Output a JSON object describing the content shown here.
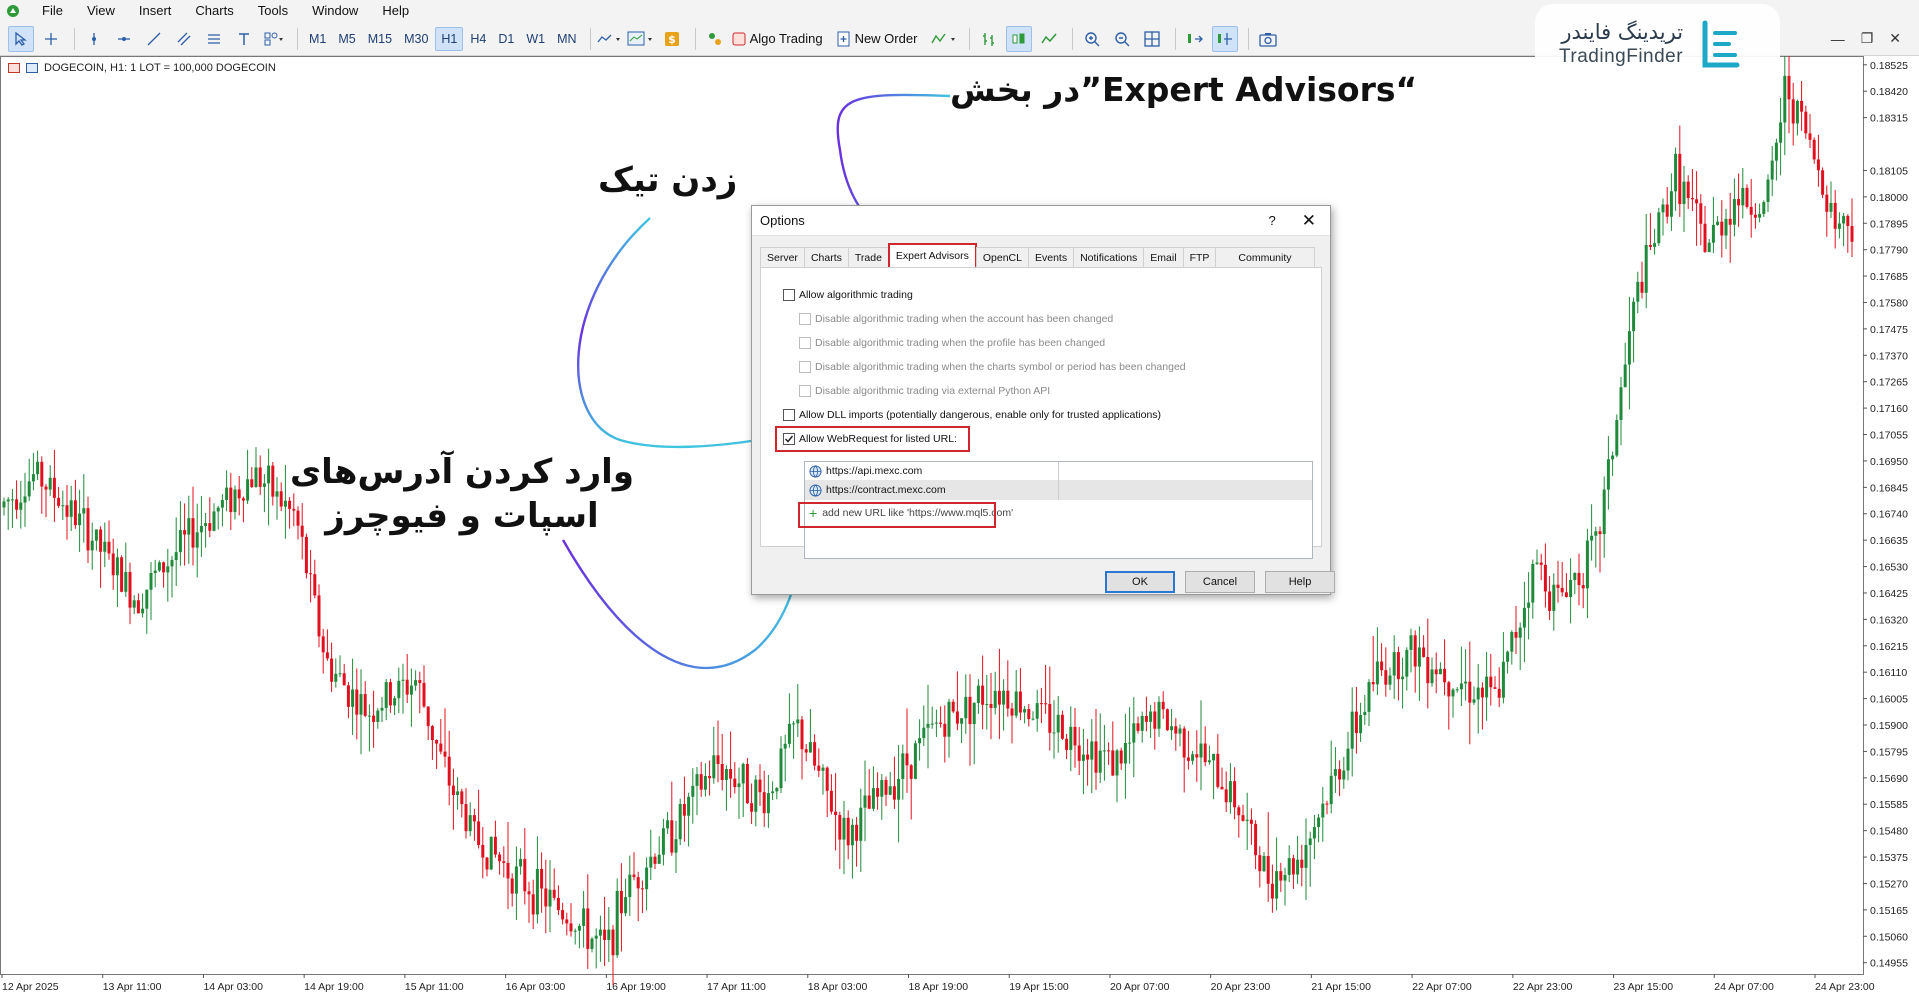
{
  "menu": [
    "File",
    "View",
    "Insert",
    "Charts",
    "Tools",
    "Window",
    "Help"
  ],
  "toolbar": {
    "timeframes": [
      "M1",
      "M5",
      "M15",
      "M30",
      "H1",
      "H4",
      "D1",
      "W1",
      "MN"
    ],
    "active_timeframe": "H1",
    "algo_trading": "Algo Trading",
    "new_order": "New Order"
  },
  "chart": {
    "header": "DOGECOIN, H1:  1 LOT = 100,000 DOGECOIN",
    "price_labels": [
      "0.18525",
      "0.18420",
      "0.18315",
      "0.18105",
      "0.18000",
      "0.17895",
      "0.17790",
      "0.17685",
      "0.17580",
      "0.17475",
      "0.17370",
      "0.17265",
      "0.17160",
      "0.17055",
      "0.16950",
      "0.16845",
      "0.16740",
      "0.16635",
      "0.16530",
      "0.16425",
      "0.16320",
      "0.16215",
      "0.16110",
      "0.16005",
      "0.15900",
      "0.15795",
      "0.15690",
      "0.15585",
      "0.15480",
      "0.15375",
      "0.15270",
      "0.15165",
      "0.15060",
      "0.14955"
    ],
    "time_labels": [
      "12 Apr 2025",
      "13 Apr 11:00",
      "14 Apr 03:00",
      "14 Apr 19:00",
      "15 Apr 11:00",
      "16 Apr 03:00",
      "16 Apr 19:00",
      "17 Apr 11:00",
      "18 Apr 03:00",
      "18 Apr 19:00",
      "19 Apr 15:00",
      "20 Apr 07:00",
      "20 Apr 23:00",
      "21 Apr 15:00",
      "22 Apr 07:00",
      "22 Apr 23:00",
      "23 Apr 15:00",
      "24 Apr 07:00",
      "24 Apr 23:00"
    ],
    "bull_color": "#1f8a3a",
    "bear_color": "#e0101e"
  },
  "logo": {
    "fa": "تریدینگ فایندر",
    "en": "TradingFinder",
    "accent": "#1ea8c8"
  },
  "annotations": {
    "expert": "در بخش”Expert Advisors“",
    "tick": "زدن تیک",
    "urls_line1": "وارد کردن آدرس‌های",
    "urls_line2": "اسپات و فیوچرز"
  },
  "dialog": {
    "title": "Options",
    "help_glyph": "?",
    "close_glyph": "✕",
    "tabs": [
      "Server",
      "Charts",
      "Trade",
      "Expert Advisors",
      "OpenCL",
      "Events",
      "Notifications",
      "Email",
      "FTP",
      "Community"
    ],
    "active_tab": "Expert Advisors",
    "options": {
      "allow_algo": "Allow algorithmic trading",
      "disable_account": "Disable algorithmic trading when the account has been changed",
      "disable_profile": "Disable algorithmic trading when the profile has been changed",
      "disable_symbol": "Disable algorithmic trading when the charts symbol or period has been changed",
      "disable_python": "Disable algorithmic trading via external Python API",
      "allow_dll": "Allow DLL imports (potentially dangerous, enable only for trusted applications)",
      "allow_webrequest": "Allow WebRequest for listed URL:"
    },
    "urls": [
      "https://api.mexc.com",
      "https://contract.mexc.com"
    ],
    "add_url": "add new URL like 'https://www.mql5.com'",
    "buttons": {
      "ok": "OK",
      "cancel": "Cancel",
      "help": "Help"
    },
    "highlight_color": "#d0272c"
  }
}
